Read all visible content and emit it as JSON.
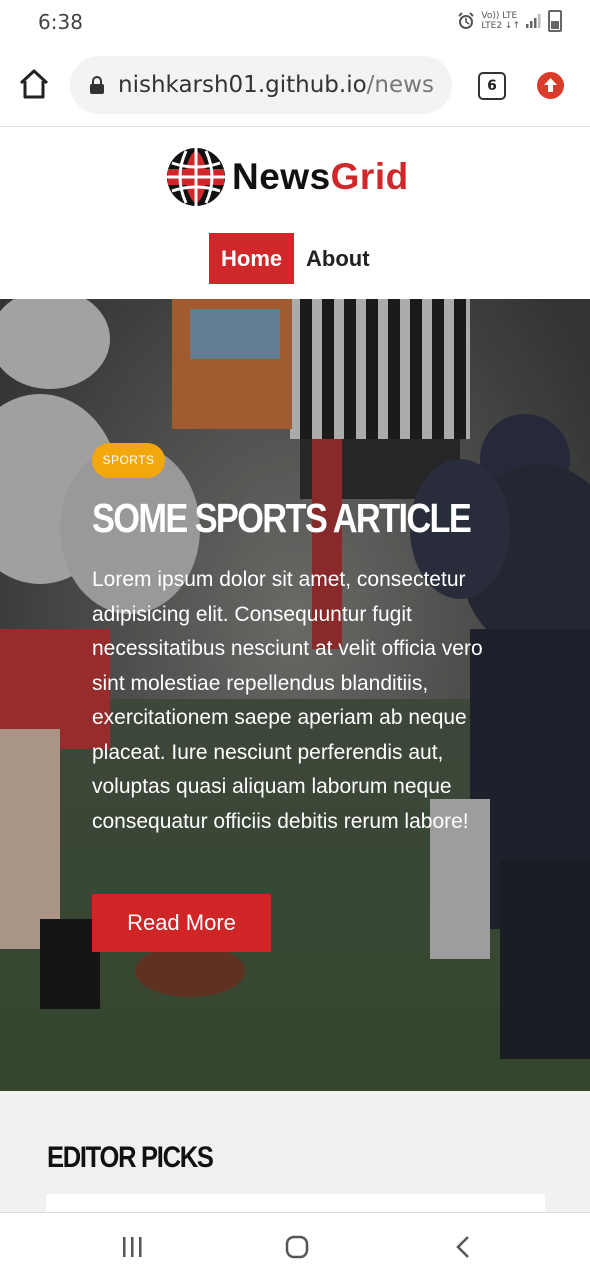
{
  "status_bar": {
    "time": "6:38",
    "network_top": "Vo)) LTE",
    "network_bottom": "LTE2 ↓↑",
    "icons": [
      "alarm-icon",
      "signal-icon",
      "battery-icon"
    ]
  },
  "browser": {
    "url_main": "nishkarsh01.github.io",
    "url_rest": "/news",
    "tab_count": "6",
    "icons": [
      "home-icon",
      "lock-icon",
      "tabs-icon",
      "upgrade-icon"
    ]
  },
  "site": {
    "logo_news": "News",
    "logo_grid": "Grid",
    "nav": {
      "home": "Home",
      "about": "About"
    },
    "colors": {
      "brand_red": "#d0282a",
      "badge_orange": "#f2a80d"
    }
  },
  "hero": {
    "badge": "SPORTS",
    "title": "SOME SPORTS ARTICLE",
    "body": "Lorem ipsum dolor sit amet, consectetur adipisicing elit. Consequuntur fugit necessitatibus nesciunt at velit officia vero sint molestiae repellendus blanditiis, exercitationem saepe aperiam ab neque placeat. Iure nesciunt perferendis aut, voluptas quasi aliquam laborum neque consequatur officiis debitis rerum labore!",
    "button": "Read More"
  },
  "editor_picks": {
    "title": "EDITOR PICKS"
  },
  "system_nav": {
    "icons": [
      "recents-icon",
      "home-circle-icon",
      "back-icon"
    ]
  }
}
